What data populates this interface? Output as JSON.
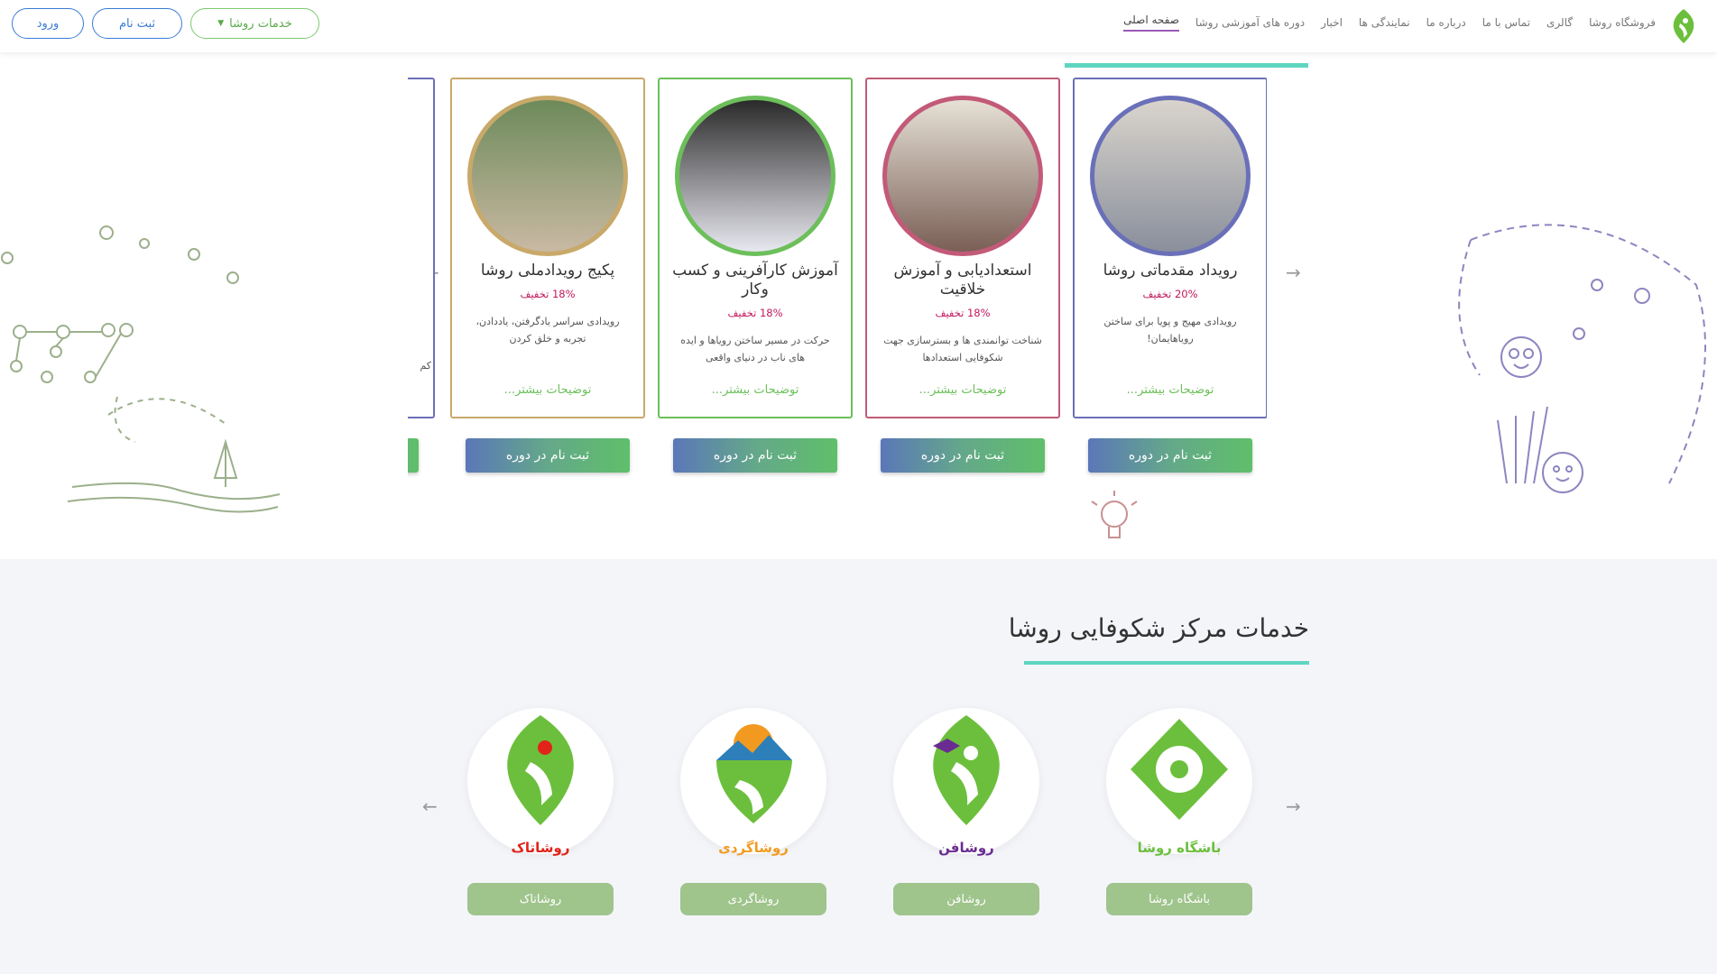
{
  "nav": {
    "items": [
      "صفحه اصلی",
      "دوره های آموزشی روشا",
      "اخبار",
      "نمایندگی ها",
      "درباره ما",
      "تماس با ما",
      "گالری",
      "فروشگاه روشا"
    ],
    "login": "ورود",
    "register": "ثبت نام",
    "services": "خدمات روشا"
  },
  "courses": [
    {
      "title": "رویداد مقدماتی روشا",
      "discount": "20% تخفیف",
      "desc": "رویدادی مهیج و پویا برای ساختن رویاهایمان!",
      "more": "توضیحات بیشتر...",
      "enroll": "ثبت نام در دوره",
      "color": "#6a70b8"
    },
    {
      "title": "استعدادیابی و آموزش خلاقیت",
      "discount": "18% تخفیف",
      "desc": "شناخت توانمندی ها و بسترسازی جهت شکوفایی استعدادها",
      "more": "توضیحات بیشتر...",
      "enroll": "ثبت نام در دوره",
      "color": "#c25a78"
    },
    {
      "title": "آموزش کارآفرینی و کسب وکار",
      "discount": "18% تخفیف",
      "desc": "حرکت در مسیر ساختن رویاها و ایده های ناب در دنیای واقعی",
      "more": "توضیحات بیشتر...",
      "enroll": "ثبت نام در دوره",
      "color": "#6cbf5a"
    },
    {
      "title": "پکیج رویدادملی روشا",
      "discount": "18% تخفیف",
      "desc": "رویدادی سراسر یادگرفتن، یاددادن، تجربه و خلق کردن",
      "more": "توضیحات بیشتر...",
      "enroll": "ثبت نام در دوره",
      "color": "#c8a96a"
    }
  ],
  "partial_desc": "کم",
  "services_section": {
    "title": "خدمات مرکز شکوفایی روشا",
    "items": [
      {
        "logo": "باشگاه روشا",
        "button": "باشگاه روشا",
        "color": "#6cbf3c"
      },
      {
        "logo": "روشافن",
        "button": "روشافن",
        "color": "#6a2c91"
      },
      {
        "logo": "روشاگردی",
        "button": "روشاگردی",
        "color": "#f29a1f"
      },
      {
        "logo": "روشاتاک",
        "button": "روشاتاک",
        "color": "#e2231a"
      }
    ]
  },
  "icons": {
    "prev": "chevron-left-icon",
    "next": "chevron-right-icon",
    "caret": "caret-down-icon"
  }
}
